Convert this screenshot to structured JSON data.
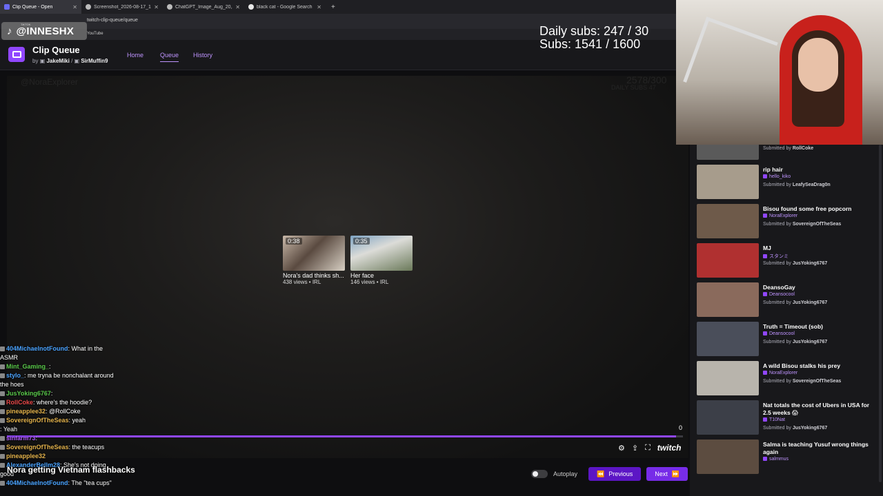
{
  "browser": {
    "tabs": [
      {
        "label": "Clip Queue - Open",
        "active": true
      },
      {
        "label": "Screenshot_2026-08-17_1749..."
      },
      {
        "label": "ChatGPT_Image_Aug_20,2026..."
      },
      {
        "label": "black cat - Google Search"
      }
    ],
    "url": "twitch-clip-queue/queue",
    "bookmark": "YouTube"
  },
  "watermark": {
    "platform": "TIKTOK",
    "handle": "@INNESHX"
  },
  "subs_overlay": {
    "daily": "Daily subs: 247 / 30",
    "total": "Subs: 1541 / 1600"
  },
  "app": {
    "title": "Clip Queue",
    "by": "by",
    "author1": "JakeMiki",
    "sep": "/",
    "author2": "SirMuffin9",
    "nav": {
      "home": "Home",
      "queue": "Queue",
      "history": "History"
    }
  },
  "player": {
    "ghost_user": "@NoraExplorer",
    "ghost_counter": "2578/300",
    "ghost_daily": "DAILY SUBS 47",
    "suggestions": [
      {
        "duration": "0:38",
        "title": "Nora's dad thinks sh...",
        "meta": "438 views • IRL"
      },
      {
        "duration": "0:35",
        "title": "Her face",
        "meta": "146 views • IRL"
      }
    ],
    "progress": 0.99,
    "count": "0",
    "brand": "twitch",
    "autoplay": "Autoplay",
    "prev": "Previous",
    "next": "Next"
  },
  "chat": [
    {
      "user": "404MichaelnotFound",
      "color": "u-blue",
      "text": ": What in the"
    },
    {
      "user": "",
      "text": "ASMR"
    },
    {
      "user": "Mint_Gaming_",
      "color": "u-green",
      "text": ": "
    },
    {
      "user": "stylo_",
      "color": "u-blue",
      "text": ": me tryna be nonchalant around"
    },
    {
      "user": "",
      "text": "the hoes"
    },
    {
      "user": "JusYoking6767",
      "color": "u-green",
      "text": ": "
    },
    {
      "user": "RollCoke",
      "color": "u-red",
      "text": ": where's the hoodie?"
    },
    {
      "user": "pineapplee32",
      "color": "u-gold",
      "text": ": @RollCoke"
    },
    {
      "user": "SovereignOfTheSeas",
      "color": "u-gold",
      "text": ": yeah"
    },
    {
      "user": "",
      "text": ": Yeah"
    },
    {
      "user": "sinfarm73",
      "color": "u-purple",
      "text": ": "
    },
    {
      "user": "SovereignOfTheSeas",
      "color": "u-gold",
      "text": ": the teacups"
    },
    {
      "user": "pineapplee32",
      "color": "u-gold",
      "text": ""
    },
    {
      "user": "AlexanderBellm28",
      "color": "u-blue",
      "text": ": She's not doing"
    },
    {
      "user": "",
      "text": "good"
    },
    {
      "user": "404MichaelnotFound",
      "color": "u-blue",
      "text": ": The \"tea cups\""
    }
  ],
  "caption": "Nora getting Vietnam flashbacks",
  "queue": [
    {
      "title": "",
      "creator": "",
      "submitter": "RollCoke",
      "color": "#5a5a5a"
    },
    {
      "title": "rip hair",
      "creator": "hello_kiko",
      "submitter": "LeafySeaDrag0n",
      "color": "#a79c8c"
    },
    {
      "title": "Bisou found some free popcorn",
      "creator": "NoraExplorer",
      "submitter": "SovereignOfTheSeas",
      "color": "#6e5a4a"
    },
    {
      "title": "MJ",
      "creator": "スタンミ",
      "submitter": "JusYoking6767",
      "color": "#b03030"
    },
    {
      "title": "DeansoGay",
      "creator": "Deansocool",
      "submitter": "JusYoking6767",
      "color": "#8a6a5c"
    },
    {
      "title": "Truth = Timeout (sob)",
      "creator": "Deansocool",
      "submitter": "JusYoking6767",
      "color": "#4a4e5a"
    },
    {
      "title": "A wild Bisou stalks his prey",
      "creator": "NoraExplorer",
      "submitter": "SovereignOfTheSeas",
      "color": "#b8b4ac"
    },
    {
      "title": "Nat totals the cost of Ubers in USA for 2.5 weeks 😱",
      "creator": "T10Nat",
      "submitter": "JusYoking6767",
      "color": "#3c3f48"
    },
    {
      "title": "Salma is teaching Yusuf wrong things again",
      "creator": "salmmus",
      "submitter": "",
      "color": "#5c4c40"
    }
  ],
  "submitted_by": "Submitted by"
}
